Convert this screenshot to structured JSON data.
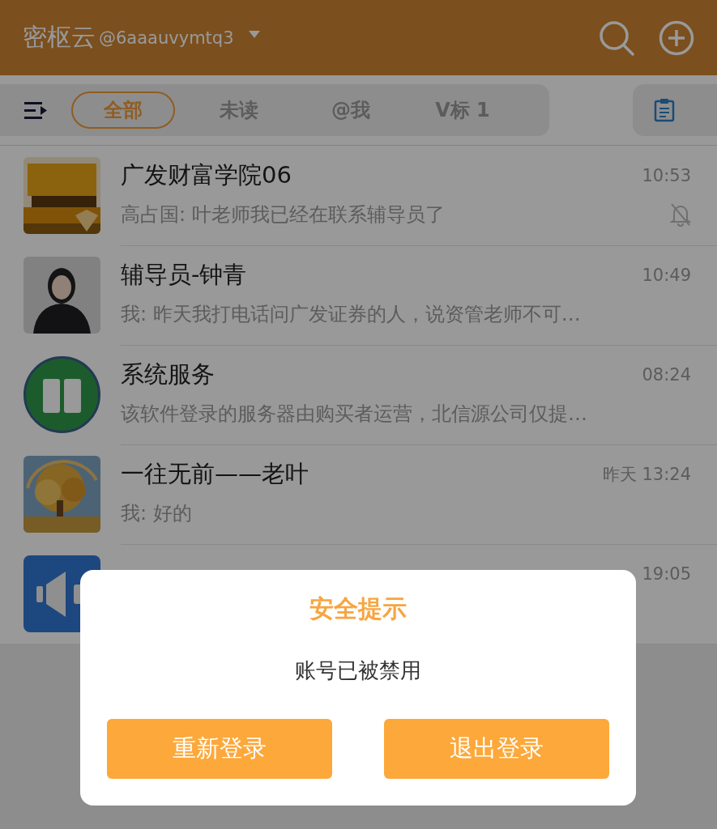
{
  "header": {
    "app_name": "密枢云",
    "account": "@6aaauvymtq3"
  },
  "tabs": [
    {
      "label": "全部",
      "selected": true
    },
    {
      "label": "未读",
      "selected": false
    },
    {
      "label": "@我",
      "selected": false
    },
    {
      "label": "V标 1",
      "selected": false
    }
  ],
  "chats": [
    {
      "kind": "picture",
      "title": "广发财富学院06",
      "time": "10:53",
      "preview": "高占国: 叶老师我已经在联系辅导员了",
      "muted": true
    },
    {
      "kind": "person",
      "title": "辅导员-钟青",
      "time": "10:49",
      "preview": "我: 昨天我打电话问广发证券的人，说资管老师不可…",
      "muted": false
    },
    {
      "kind": "book",
      "title": "系统服务",
      "time": "08:24",
      "preview": "该软件登录的服务器由购买者运营，北信源公司仅提…",
      "muted": false
    },
    {
      "kind": "tree",
      "title": "一往无前——老叶",
      "time": "昨天 13:24",
      "preview": "我: 好的",
      "muted": false
    },
    {
      "kind": "speaker",
      "time": "19:05",
      "muted": false
    }
  ],
  "dialog": {
    "title": "安全提示",
    "message": "账号已被禁用",
    "buttons": [
      "重新登录",
      "退出登录"
    ]
  }
}
